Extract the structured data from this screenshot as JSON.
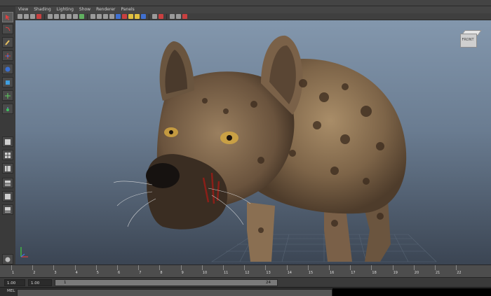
{
  "menus": [
    "View",
    "Shading",
    "Lighting",
    "Show",
    "Renderer",
    "Panels"
  ],
  "viewcube_label": "FRONT",
  "timeline": {
    "ticks": [
      "1",
      "2",
      "3",
      "4",
      "5",
      "6",
      "7",
      "8",
      "9",
      "10",
      "11",
      "12",
      "13",
      "14",
      "15",
      "16",
      "17",
      "18",
      "19",
      "20",
      "21",
      "22"
    ]
  },
  "range": {
    "start_field": "1.00",
    "start_anim": "1.00",
    "slider_start": "1",
    "slider_end": "24"
  },
  "cmd": {
    "label": "MEL"
  },
  "colors": {
    "viewport_top": "#8397ad",
    "viewport_bottom": "#3b4553"
  },
  "viewport": {
    "subject": "hyena-3d-model"
  }
}
